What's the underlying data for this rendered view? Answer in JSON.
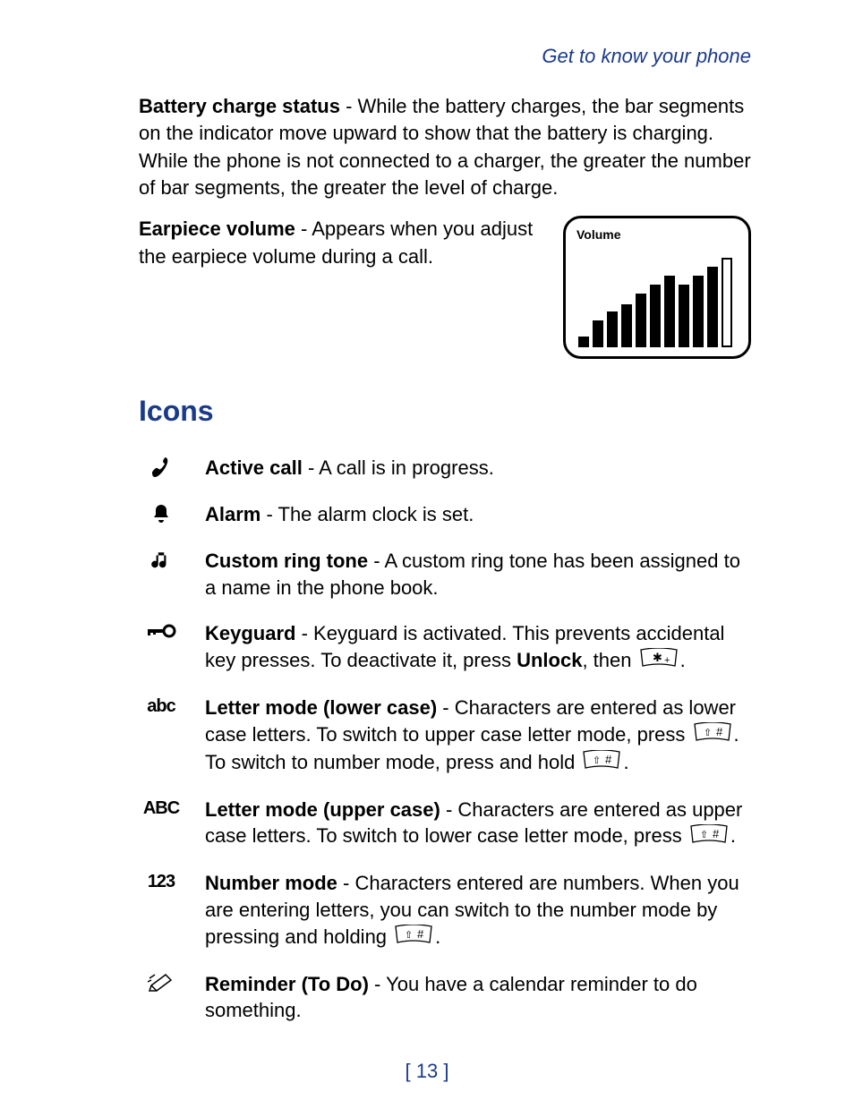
{
  "header": {
    "link": "Get to know your phone"
  },
  "battery": {
    "title": "Battery charge status",
    "text": " - While the battery charges, the bar segments on the indicator move upward to show that the battery is charging. While the phone is not connected to a charger, the greater the number of bar segments, the greater the level of charge."
  },
  "earpiece": {
    "title": "Earpiece volume",
    "text": " - Appears when you adjust the earpiece volume during a call.",
    "volume_label": "Volume"
  },
  "section": {
    "title": "Icons"
  },
  "icons": {
    "active_call": {
      "title": "Active call",
      "text": " - A call is in progress."
    },
    "alarm": {
      "title": "Alarm",
      "text": " - The alarm clock is set."
    },
    "custom_ring": {
      "title": "Custom ring tone",
      "text": " - A custom ring tone has been assigned to a name in the phone book."
    },
    "keyguard": {
      "title": "Keyguard",
      "text_a": " - Keyguard is activated. This prevents accidental key presses. To deactivate it, press ",
      "unlock": "Unlock",
      "text_b": ", then ",
      "text_c": "."
    },
    "letter_lower": {
      "title": "Letter mode (lower case)",
      "text_a": " - Characters are entered as lower case letters. To switch to upper case letter mode, press ",
      "text_b": ". To switch to number mode, press and hold ",
      "text_c": "."
    },
    "letter_upper": {
      "title": "Letter mode (upper case)",
      "text_a": " - Characters are entered as upper case letters. To switch to lower case letter mode, press ",
      "text_b": "."
    },
    "number_mode": {
      "title": "Number mode",
      "text_a": " - Characters entered are numbers. When you are entering letters, you can switch to the number mode by pressing and holding ",
      "text_b": "."
    },
    "reminder": {
      "title": "Reminder (To Do)",
      "text": " - You have a calendar reminder to do something."
    }
  },
  "glyphs": {
    "abc_lower": "abc",
    "abc_upper": "ABC",
    "num": "123"
  },
  "page": {
    "number": "[ 13 ]"
  }
}
